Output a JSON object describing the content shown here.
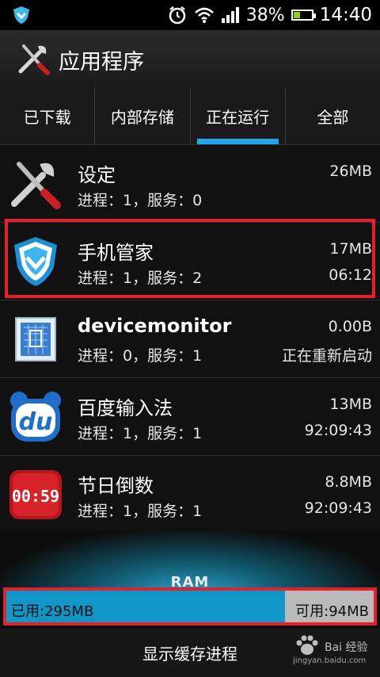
{
  "status_bar": {
    "battery": "38%",
    "time": "14:40",
    "battery_level": 0.38
  },
  "header": {
    "title": "应用程序"
  },
  "tabs": [
    {
      "label": "已下载"
    },
    {
      "label": "内部存储"
    },
    {
      "label": "正在运行",
      "active": true
    },
    {
      "label": "全部"
    }
  ],
  "apps": [
    {
      "name": "设定",
      "detail": "进程：1，服务：0",
      "size": "26MB",
      "time": "",
      "icon": "settings-icon"
    },
    {
      "name": "手机管家",
      "detail": "进程：1，服务：2",
      "size": "17MB",
      "time": "06:12",
      "icon": "phone-manager-icon"
    },
    {
      "name": "devicemonitor",
      "detail": "进程：0，服务：1",
      "size": "0.00B",
      "time": "正在重新启动",
      "icon": "device-monitor-icon"
    },
    {
      "name": "百度输入法",
      "detail": "进程：1，服务：1",
      "size": "13MB",
      "time": "92:09:43",
      "icon": "baidu-input-icon"
    },
    {
      "name": "节日倒数",
      "detail": "进程：1，服务：1",
      "size": "8.8MB",
      "time": "92:09:43",
      "icon": "holiday-countdown-icon"
    }
  ],
  "ram": {
    "label": "RAM",
    "used": "已用:295MB",
    "free": "可用:94MB",
    "used_fraction": 0.758
  },
  "bottom": {
    "button": "显示缓存进程"
  },
  "watermark": {
    "text": "Bai 经验",
    "url": "jingyan.baidu.com"
  },
  "colors": {
    "accent": "#20a7e8",
    "highlight": "#e6202a",
    "ram_used": "#0f95c6",
    "ram_free": "#b9b9b9"
  }
}
